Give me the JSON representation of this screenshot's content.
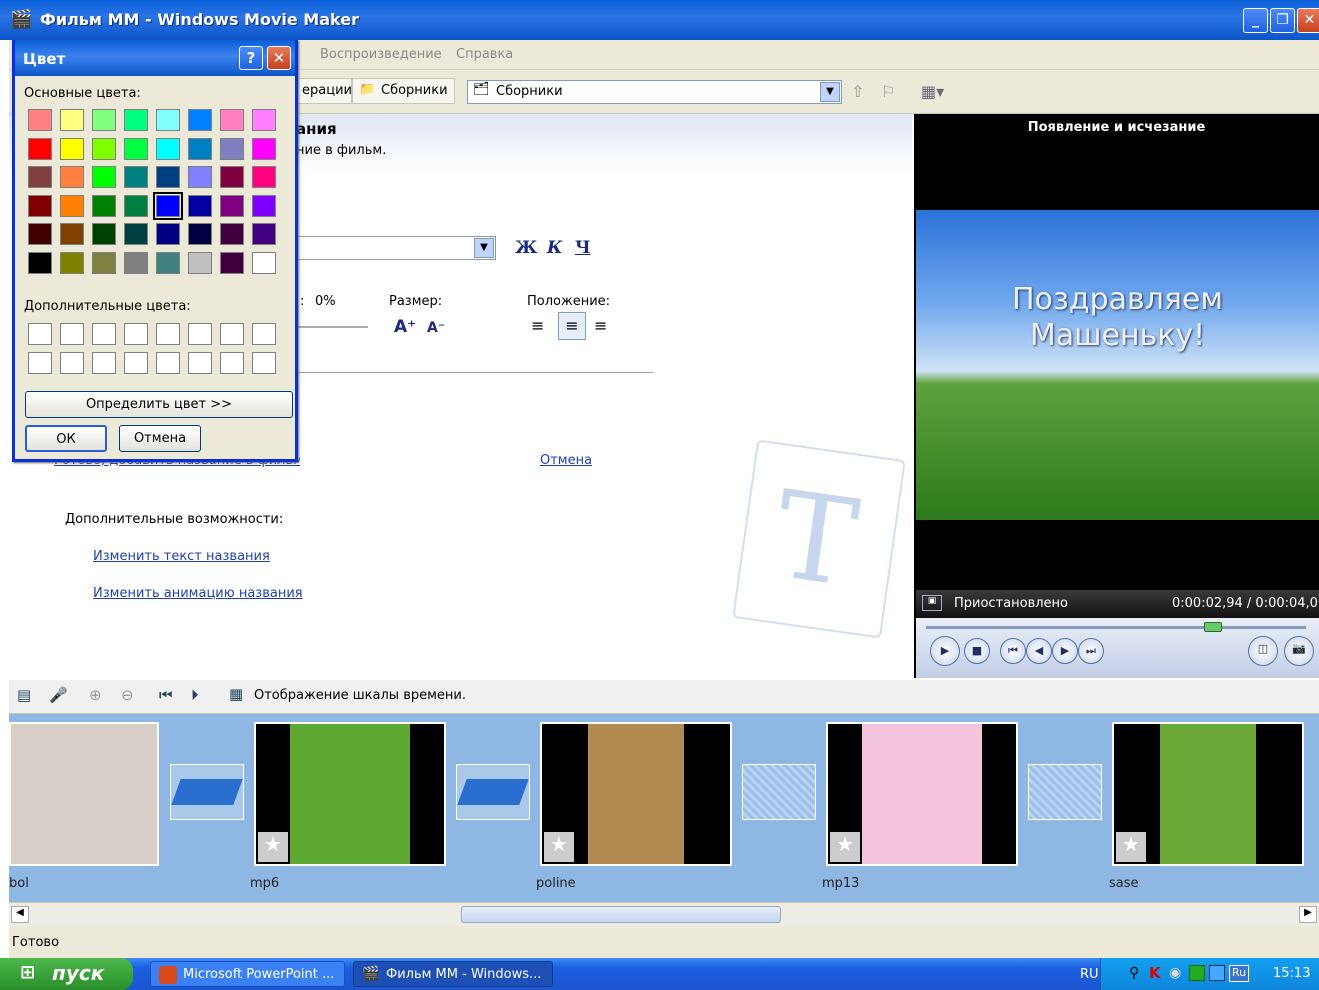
{
  "window": {
    "title": "Фильм ММ - Windows Movie Maker",
    "minimize": "_",
    "restore": "❐",
    "close": "✕"
  },
  "menu": {
    "items": [
      "Воспроизведение",
      "Справка"
    ]
  },
  "toolbar": {
    "operations_label": "ерации",
    "collections_label": "Сборники",
    "collections_combo": "Сборники"
  },
  "task": {
    "heading_part": "ания",
    "subheading_part": "ние в фильм.",
    "bold_btn": "Ж",
    "italic_btn": "К",
    "underline_btn": "Ч",
    "transparency_label": ":",
    "transparency_value": "0%",
    "size_label": "Размер:",
    "position_label": "Положение:",
    "done_link": "Готово, добавить название в фильм",
    "cancel_link": "Отмена",
    "more_label": "Дополнительные возможности:",
    "change_text_link": "Изменить текст названия",
    "change_anim_link": "Изменить анимацию названия"
  },
  "preview": {
    "title": "Появление и исчезание",
    "overlay_line1": "Поздравляем",
    "overlay_line2": "Машеньку!",
    "status": "Приостановлено",
    "time": "0:00:02,94 / 0:00:04,00"
  },
  "storyboard": {
    "toolbar_label": "Отображение шкалы времени.",
    "clips": [
      {
        "name": "bol",
        "color": "#d8d0c8"
      },
      {
        "name": "mp6",
        "color": "#5fa832"
      },
      {
        "name": "poline",
        "color": "#b08a50"
      },
      {
        "name": "mp13",
        "color": "#f4c4dc"
      },
      {
        "name": "sase",
        "color": "#6aa838"
      }
    ]
  },
  "status": {
    "text": "Готово"
  },
  "taskbar": {
    "start": "пуск",
    "tasks": [
      "Microsoft PowerPoint ...",
      "Фильм ММ - Windows..."
    ],
    "lang": "RU",
    "tray_lang": "Ru",
    "clock": "15:13"
  },
  "color_dialog": {
    "title": "Цвет",
    "help": "?",
    "close": "✕",
    "basic_label": "Основные цвета:",
    "custom_label": "Дополнительные цвета:",
    "define_btn": "Определить цвет >>",
    "ok_btn": "ОК",
    "cancel_btn": "Отмена",
    "basic_colors": [
      "#ff8080",
      "#ffff80",
      "#80ff80",
      "#00ff80",
      "#80ffff",
      "#0080ff",
      "#ff80c0",
      "#ff80ff",
      "#ff0000",
      "#ffff00",
      "#80ff00",
      "#00ff40",
      "#00ffff",
      "#0080c0",
      "#8080c0",
      "#ff00ff",
      "#804040",
      "#ff8040",
      "#00ff00",
      "#008080",
      "#004080",
      "#8080ff",
      "#800040",
      "#ff0080",
      "#800000",
      "#ff8000",
      "#008000",
      "#008040",
      "#0000ff",
      "#0000a0",
      "#800080",
      "#8000ff",
      "#400000",
      "#804000",
      "#004000",
      "#004040",
      "#000080",
      "#000040",
      "#400040",
      "#400080",
      "#000000",
      "#808000",
      "#808040",
      "#808080",
      "#408080",
      "#c0c0c0",
      "#400040",
      "#ffffff"
    ],
    "selected_index": 28
  }
}
